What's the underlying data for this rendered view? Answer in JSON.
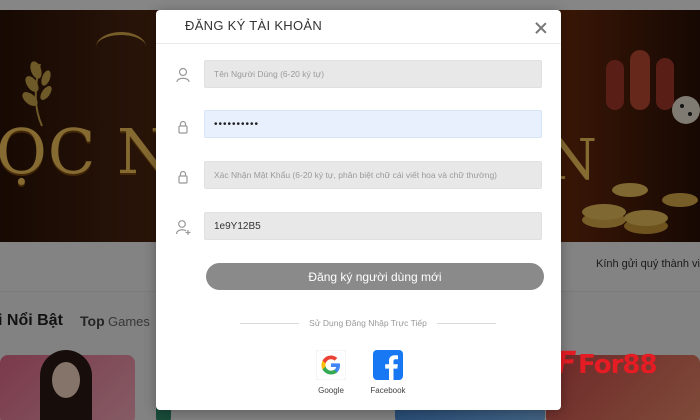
{
  "background": {
    "banner_text": "ỌC NHA",
    "banner_text_right": "N",
    "notice": "Kính gửi quý thành viên",
    "section_title": "i Nổi Bật",
    "section_top": "Top",
    "section_games": "Games",
    "brand": "For88"
  },
  "modal": {
    "title": "ĐĂNG KÝ TÀI KHOẢN",
    "close_icon": "close-icon",
    "fields": {
      "username_placeholder": "Tên Người Dùng (6-20 ký tự)",
      "password_value": "••••••••••",
      "confirm_placeholder": "Xác Nhận Mật Khẩu (6-20 ký tự,  phân biệt chữ cái viết hoa và chữ thường)",
      "referral_value": "1e9Y12B5"
    },
    "submit_label": "Đăng ký người dùng mới",
    "divider_text": "Sử Dụng Đăng Nhập Trực Tiếp",
    "social": {
      "google_label": "Google",
      "facebook_label": "Facebook"
    }
  },
  "colors": {
    "brand": "#e51c23",
    "button": "#8a8a8a",
    "active_field": "#e8f0fe",
    "field": "#e8e8e8"
  }
}
